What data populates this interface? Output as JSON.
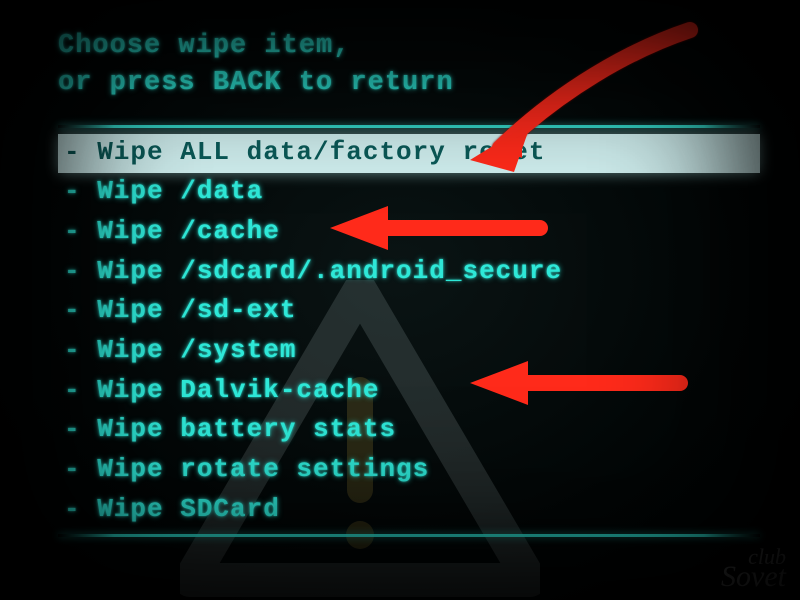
{
  "header": {
    "line1": "Choose wipe item,",
    "line2": "or press BACK to return"
  },
  "menu": {
    "prefix": "- ",
    "items": [
      {
        "label": "Wipe ALL data/factory reset",
        "selected": true
      },
      {
        "label": "Wipe /data",
        "selected": false
      },
      {
        "label": "Wipe /cache",
        "selected": false
      },
      {
        "label": "Wipe /sdcard/.android_secure",
        "selected": false
      },
      {
        "label": "Wipe /sd-ext",
        "selected": false
      },
      {
        "label": "Wipe /system",
        "selected": false
      },
      {
        "label": "Wipe Dalvik-cache",
        "selected": false
      },
      {
        "label": "Wipe battery stats",
        "selected": false
      },
      {
        "label": "Wipe rotate settings",
        "selected": false
      },
      {
        "label": "Wipe SDCard",
        "selected": false
      }
    ]
  },
  "annotations": {
    "arrows_point_to_items": [
      0,
      2,
      6
    ]
  },
  "watermark": {
    "line1": "club",
    "line2": "Sovet"
  },
  "colors": {
    "text": "#2ee8d8",
    "highlight_bg": "#cfeeee",
    "highlight_fg": "#0a5a58",
    "arrow": "#ff2a1a"
  }
}
